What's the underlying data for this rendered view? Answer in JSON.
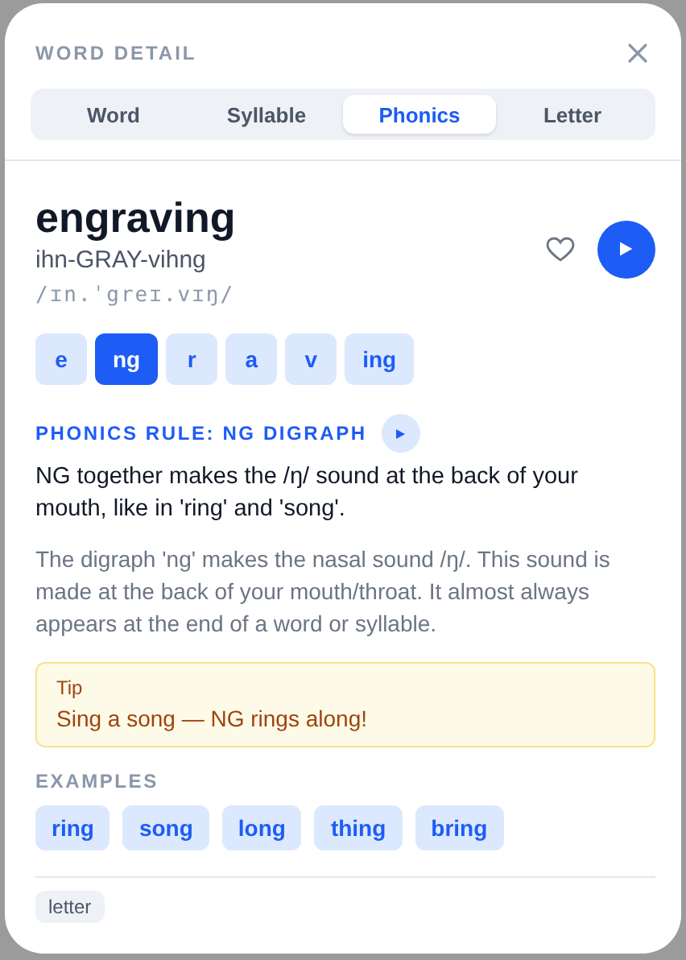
{
  "dialog": {
    "title": "WORD DETAIL"
  },
  "tabs": [
    {
      "label": "Word",
      "selected": false
    },
    {
      "label": "Syllable",
      "selected": false
    },
    {
      "label": "Phonics",
      "selected": true
    },
    {
      "label": "Letter",
      "selected": false
    }
  ],
  "word": {
    "text": "engraving",
    "respelling": "ihn-GRAY-vihng",
    "ipa": "/ɪn.ˈgreɪ.vɪŋ/",
    "favorited": false
  },
  "segments": [
    {
      "label": "e",
      "selected": false
    },
    {
      "label": "ng",
      "selected": true
    },
    {
      "label": "r",
      "selected": false
    },
    {
      "label": "a",
      "selected": false
    },
    {
      "label": "v",
      "selected": false
    },
    {
      "label": "ing",
      "selected": false
    }
  ],
  "rule": {
    "title": "PHONICS RULE: NG DIGRAPH",
    "summary": "NG together makes the /ŋ/ sound at the back of your mouth, like in 'ring' and 'song'.",
    "detail": "The digraph 'ng' makes the nasal sound /ŋ/. This sound is made at the back of your mouth/throat. It almost always appears at the end of a word or syllable."
  },
  "tip": {
    "label": "Tip",
    "text": "Sing a song — NG rings along!"
  },
  "examples": {
    "heading": "EXAMPLES",
    "words": [
      "ring",
      "song",
      "long",
      "thing",
      "bring"
    ]
  },
  "tags": [
    "letter"
  ]
}
